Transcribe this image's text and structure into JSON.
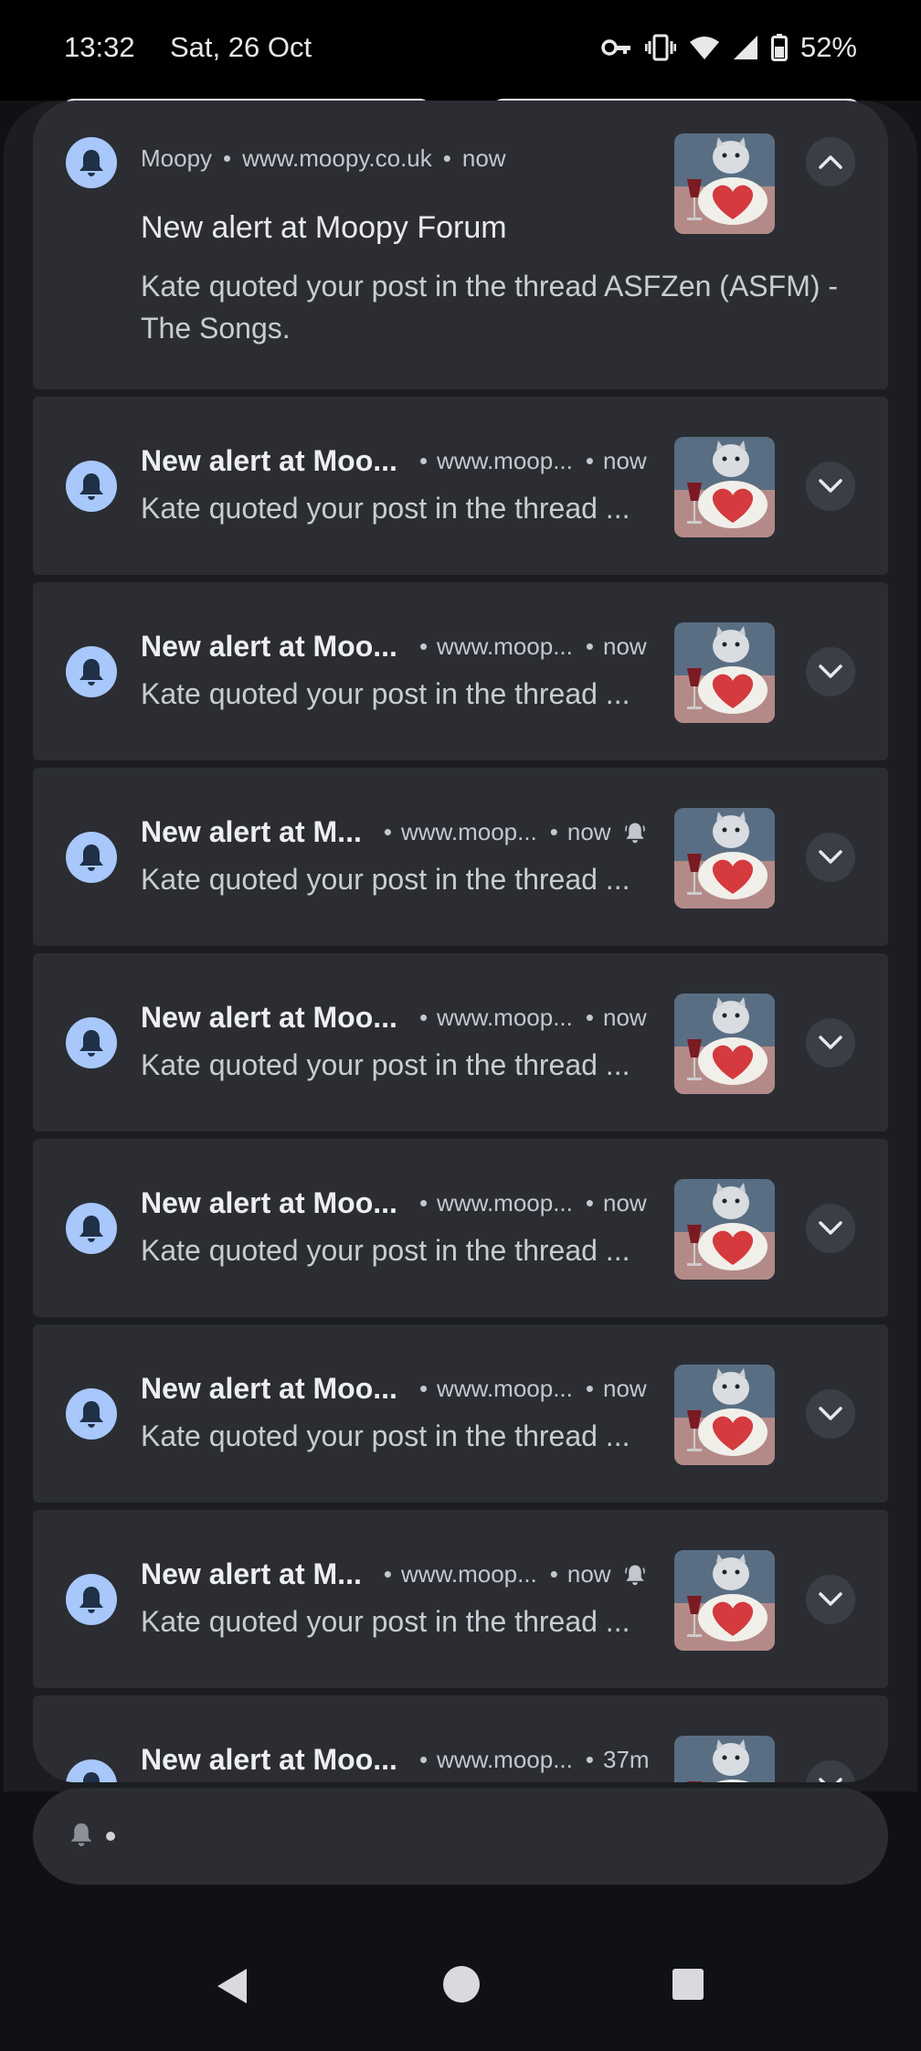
{
  "status_bar": {
    "time": "13:32",
    "date": "Sat, 26 Oct",
    "battery": "52%"
  },
  "expanded_notification": {
    "app": "Moopy",
    "site": "www.moopy.co.uk",
    "time": "now",
    "title": "New alert at Moopy Forum",
    "body": "Kate quoted your post in the thread ASFZen (ASFM) - The Songs."
  },
  "notifications": [
    {
      "title": "New alert at Moo...",
      "site": "www.moop...",
      "time": "now",
      "body": "Kate quoted your post in the thread ...",
      "muted": false
    },
    {
      "title": "New alert at Moo...",
      "site": "www.moop...",
      "time": "now",
      "body": "Kate quoted your post in the thread ...",
      "muted": false
    },
    {
      "title": "New alert at M...",
      "site": "www.moop...",
      "time": "now",
      "body": "Kate quoted your post in the thread ...",
      "muted": true
    },
    {
      "title": "New alert at Moo...",
      "site": "www.moop...",
      "time": "now",
      "body": "Kate quoted your post in the thread ...",
      "muted": false
    },
    {
      "title": "New alert at Moo...",
      "site": "www.moop...",
      "time": "now",
      "body": "Kate quoted your post in the thread ...",
      "muted": false
    },
    {
      "title": "New alert at Moo...",
      "site": "www.moop...",
      "time": "now",
      "body": "Kate quoted your post in the thread ...",
      "muted": false
    },
    {
      "title": "New alert at M...",
      "site": "www.moop...",
      "time": "now",
      "body": "Kate quoted your post in the thread ...",
      "muted": true
    },
    {
      "title": "New alert at Moo...",
      "site": "www.moop...",
      "time": "37m",
      "body": "Kate quoted your post in the thread ...",
      "muted": false
    }
  ],
  "colors": {
    "accent": "#a8c7fa",
    "card": "#2b2d33",
    "background": "#0f1114"
  },
  "icons": {
    "app": "bell-icon",
    "expand": "chevron-down-icon",
    "collapse": "chevron-up-icon",
    "alerting": "ringing-bell-icon"
  }
}
